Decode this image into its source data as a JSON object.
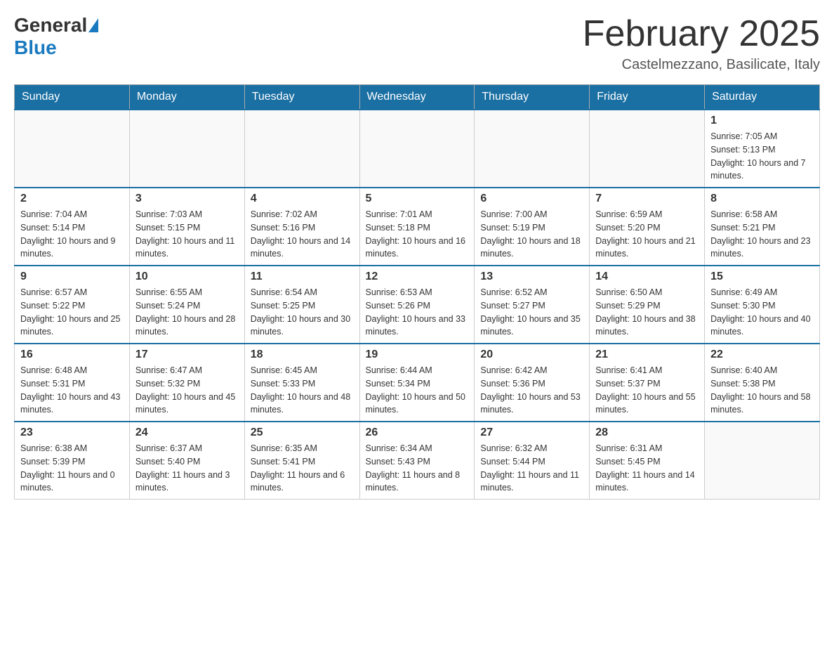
{
  "header": {
    "logo_general": "General",
    "logo_blue": "Blue",
    "month_title": "February 2025",
    "subtitle": "Castelmezzano, Basilicate, Italy"
  },
  "days_of_week": [
    "Sunday",
    "Monday",
    "Tuesday",
    "Wednesday",
    "Thursday",
    "Friday",
    "Saturday"
  ],
  "weeks": [
    [
      {
        "day": "",
        "info": ""
      },
      {
        "day": "",
        "info": ""
      },
      {
        "day": "",
        "info": ""
      },
      {
        "day": "",
        "info": ""
      },
      {
        "day": "",
        "info": ""
      },
      {
        "day": "",
        "info": ""
      },
      {
        "day": "1",
        "info": "Sunrise: 7:05 AM\nSunset: 5:13 PM\nDaylight: 10 hours and 7 minutes."
      }
    ],
    [
      {
        "day": "2",
        "info": "Sunrise: 7:04 AM\nSunset: 5:14 PM\nDaylight: 10 hours and 9 minutes."
      },
      {
        "day": "3",
        "info": "Sunrise: 7:03 AM\nSunset: 5:15 PM\nDaylight: 10 hours and 11 minutes."
      },
      {
        "day": "4",
        "info": "Sunrise: 7:02 AM\nSunset: 5:16 PM\nDaylight: 10 hours and 14 minutes."
      },
      {
        "day": "5",
        "info": "Sunrise: 7:01 AM\nSunset: 5:18 PM\nDaylight: 10 hours and 16 minutes."
      },
      {
        "day": "6",
        "info": "Sunrise: 7:00 AM\nSunset: 5:19 PM\nDaylight: 10 hours and 18 minutes."
      },
      {
        "day": "7",
        "info": "Sunrise: 6:59 AM\nSunset: 5:20 PM\nDaylight: 10 hours and 21 minutes."
      },
      {
        "day": "8",
        "info": "Sunrise: 6:58 AM\nSunset: 5:21 PM\nDaylight: 10 hours and 23 minutes."
      }
    ],
    [
      {
        "day": "9",
        "info": "Sunrise: 6:57 AM\nSunset: 5:22 PM\nDaylight: 10 hours and 25 minutes."
      },
      {
        "day": "10",
        "info": "Sunrise: 6:55 AM\nSunset: 5:24 PM\nDaylight: 10 hours and 28 minutes."
      },
      {
        "day": "11",
        "info": "Sunrise: 6:54 AM\nSunset: 5:25 PM\nDaylight: 10 hours and 30 minutes."
      },
      {
        "day": "12",
        "info": "Sunrise: 6:53 AM\nSunset: 5:26 PM\nDaylight: 10 hours and 33 minutes."
      },
      {
        "day": "13",
        "info": "Sunrise: 6:52 AM\nSunset: 5:27 PM\nDaylight: 10 hours and 35 minutes."
      },
      {
        "day": "14",
        "info": "Sunrise: 6:50 AM\nSunset: 5:29 PM\nDaylight: 10 hours and 38 minutes."
      },
      {
        "day": "15",
        "info": "Sunrise: 6:49 AM\nSunset: 5:30 PM\nDaylight: 10 hours and 40 minutes."
      }
    ],
    [
      {
        "day": "16",
        "info": "Sunrise: 6:48 AM\nSunset: 5:31 PM\nDaylight: 10 hours and 43 minutes."
      },
      {
        "day": "17",
        "info": "Sunrise: 6:47 AM\nSunset: 5:32 PM\nDaylight: 10 hours and 45 minutes."
      },
      {
        "day": "18",
        "info": "Sunrise: 6:45 AM\nSunset: 5:33 PM\nDaylight: 10 hours and 48 minutes."
      },
      {
        "day": "19",
        "info": "Sunrise: 6:44 AM\nSunset: 5:34 PM\nDaylight: 10 hours and 50 minutes."
      },
      {
        "day": "20",
        "info": "Sunrise: 6:42 AM\nSunset: 5:36 PM\nDaylight: 10 hours and 53 minutes."
      },
      {
        "day": "21",
        "info": "Sunrise: 6:41 AM\nSunset: 5:37 PM\nDaylight: 10 hours and 55 minutes."
      },
      {
        "day": "22",
        "info": "Sunrise: 6:40 AM\nSunset: 5:38 PM\nDaylight: 10 hours and 58 minutes."
      }
    ],
    [
      {
        "day": "23",
        "info": "Sunrise: 6:38 AM\nSunset: 5:39 PM\nDaylight: 11 hours and 0 minutes."
      },
      {
        "day": "24",
        "info": "Sunrise: 6:37 AM\nSunset: 5:40 PM\nDaylight: 11 hours and 3 minutes."
      },
      {
        "day": "25",
        "info": "Sunrise: 6:35 AM\nSunset: 5:41 PM\nDaylight: 11 hours and 6 minutes."
      },
      {
        "day": "26",
        "info": "Sunrise: 6:34 AM\nSunset: 5:43 PM\nDaylight: 11 hours and 8 minutes."
      },
      {
        "day": "27",
        "info": "Sunrise: 6:32 AM\nSunset: 5:44 PM\nDaylight: 11 hours and 11 minutes."
      },
      {
        "day": "28",
        "info": "Sunrise: 6:31 AM\nSunset: 5:45 PM\nDaylight: 11 hours and 14 minutes."
      },
      {
        "day": "",
        "info": ""
      }
    ]
  ]
}
